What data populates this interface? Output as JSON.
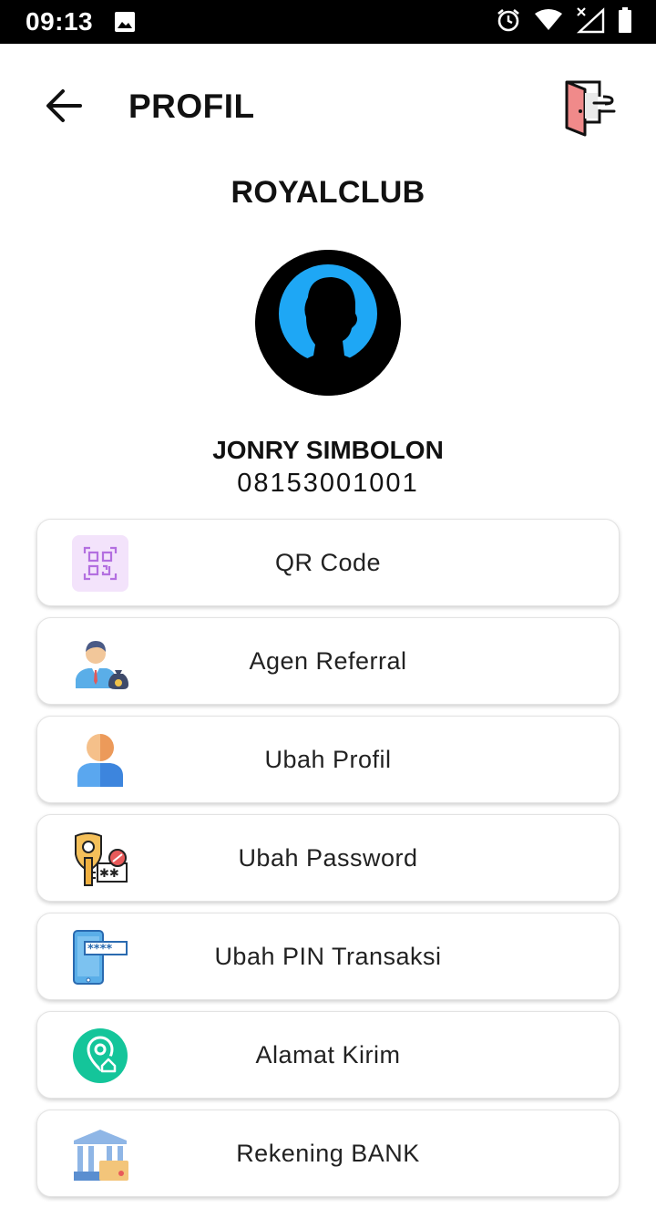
{
  "status_bar": {
    "time": "09:13",
    "icons": [
      "gallery-icon",
      "alarm-icon",
      "wifi-icon",
      "signal-off-icon",
      "battery-icon"
    ]
  },
  "app_bar": {
    "title": "PROFIL",
    "back_icon": "arrow-left-icon",
    "logout_icon": "door-exit-icon"
  },
  "profile": {
    "brand": "ROYALCLUB",
    "name": "JONRY SIMBOLON",
    "phone": "08153001001"
  },
  "menu": {
    "items": [
      {
        "label": "QR Code",
        "icon": "qr-code-icon"
      },
      {
        "label": "Agen Referral",
        "icon": "agent-icon"
      },
      {
        "label": "Ubah Profil",
        "icon": "user-icon"
      },
      {
        "label": "Ubah Password",
        "icon": "password-key-icon"
      },
      {
        "label": "Ubah PIN Transaksi",
        "icon": "phone-pin-icon"
      },
      {
        "label": "Alamat Kirim",
        "icon": "location-home-icon"
      },
      {
        "label": "Rekening BANK",
        "icon": "bank-icon"
      }
    ]
  },
  "colors": {
    "status_bar": "#000000",
    "background": "#ffffff",
    "avatar_ring": "#1ea7f5",
    "qr_tint": "#f3e3fb"
  }
}
